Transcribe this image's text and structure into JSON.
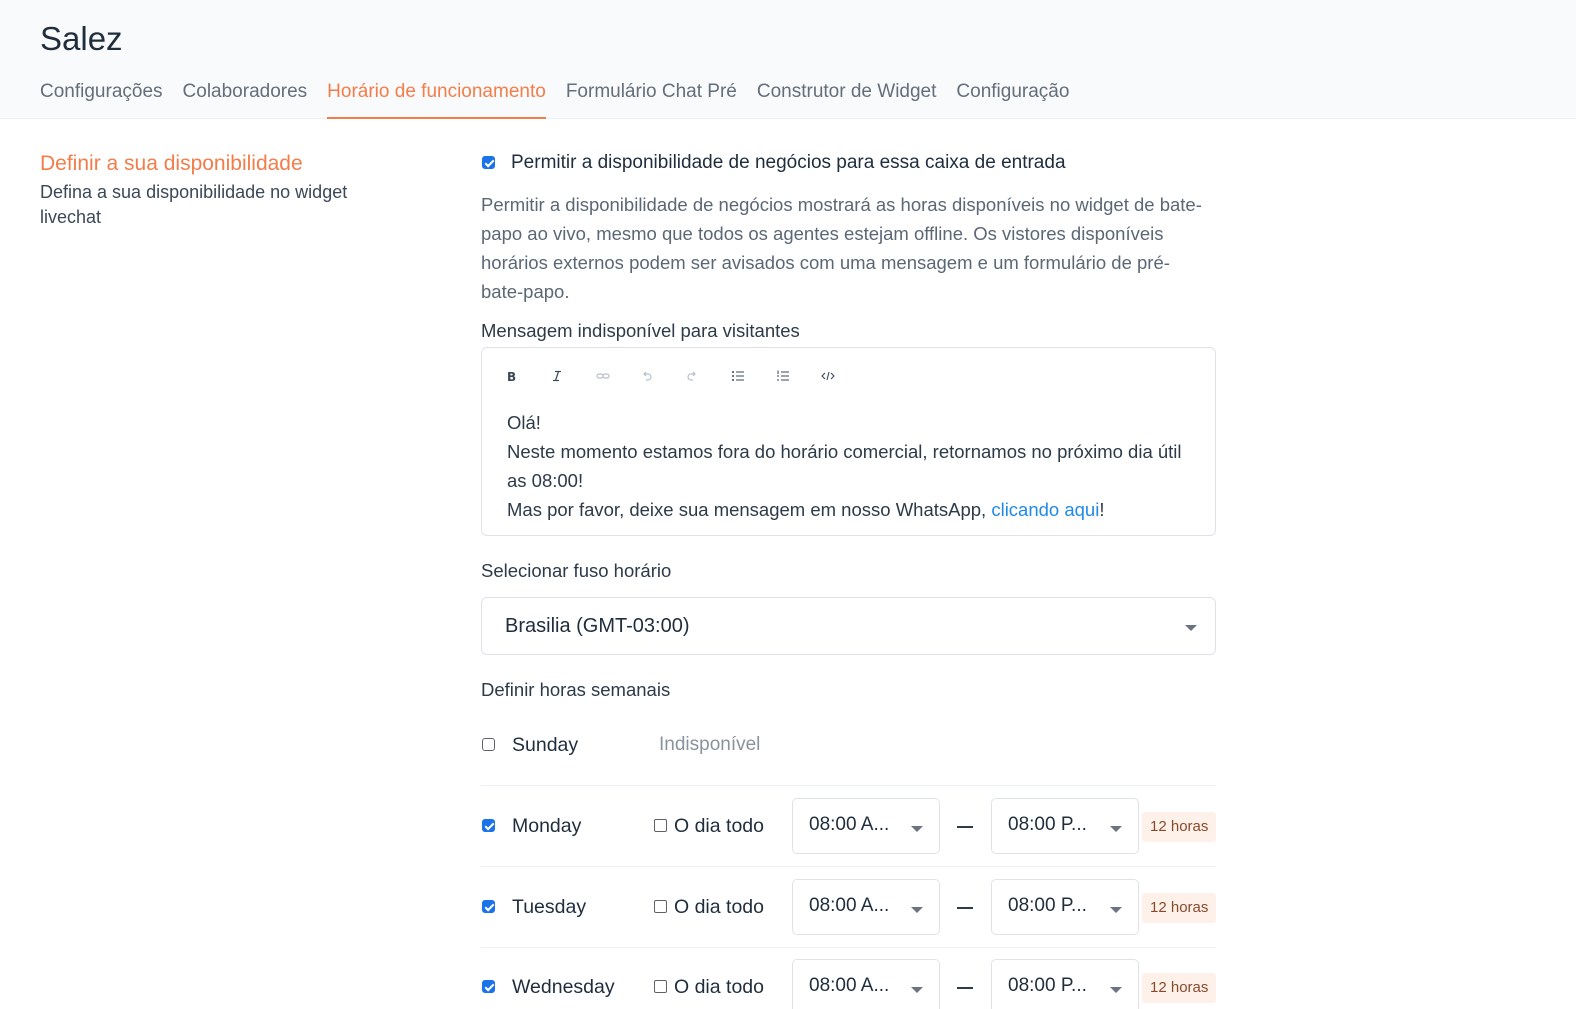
{
  "app": {
    "title": "Salez"
  },
  "tabs": [
    {
      "label": "Configurações",
      "active": false
    },
    {
      "label": "Colaboradores",
      "active": false
    },
    {
      "label": "Horário de funcionamento",
      "active": true
    },
    {
      "label": "Formulário Chat Pré",
      "active": false
    },
    {
      "label": "Construtor de Widget",
      "active": false
    },
    {
      "label": "Configuração",
      "active": false
    }
  ],
  "sidebar": {
    "title": "Definir a sua disponibilidade",
    "description": "Defina a sua disponibilidade no widget livechat"
  },
  "availability": {
    "enabled": true,
    "label": "Permitir a disponibilidade de negócios para essa caixa de entrada",
    "help": "Permitir a disponibilidade de negócios mostrará as horas disponíveis no widget de bate-papo ao vivo, mesmo que todos os agentes estejam offline. Os vistores disponíveis horários externos podem ser avisados com uma mensagem e um formulário de pré-bate-papo."
  },
  "message": {
    "label": "Mensagem indisponível para visitantes",
    "toolbar": [
      "bold-icon",
      "italic-icon",
      "link-icon",
      "undo-icon",
      "redo-icon",
      "bullet-list-icon",
      "ordered-list-icon",
      "code-icon"
    ],
    "line1": "Olá!",
    "line2": "Neste momento estamos fora do horário comercial, retornamos no próximo dia útil as 08:00!",
    "line3_prefix": "Mas por favor, deixe sua mensagem em nosso WhatsApp, ",
    "line3_link": "clicando aqui",
    "line3_suffix": "!"
  },
  "timezone": {
    "label": "Selecionar fuso horário",
    "value": "Brasilia (GMT-03:00)"
  },
  "weekly": {
    "label": "Definir horas semanais",
    "unavailable_label": "Indisponível",
    "all_day_label": "O dia todo",
    "days": [
      {
        "name": "Sunday",
        "enabled": false
      },
      {
        "name": "Monday",
        "enabled": true,
        "from": "08:00 A...",
        "to": "08:00 P...",
        "hours": "12 horas"
      },
      {
        "name": "Tuesday",
        "enabled": true,
        "from": "08:00 A...",
        "to": "08:00 P...",
        "hours": "12 horas"
      },
      {
        "name": "Wednesday",
        "enabled": true,
        "from": "08:00 A...",
        "to": "08:00 P...",
        "hours": "12 horas"
      }
    ]
  },
  "colors": {
    "accent": "#f37d4a",
    "link": "#1f8ae8",
    "checkbox": "#1a73e8"
  }
}
